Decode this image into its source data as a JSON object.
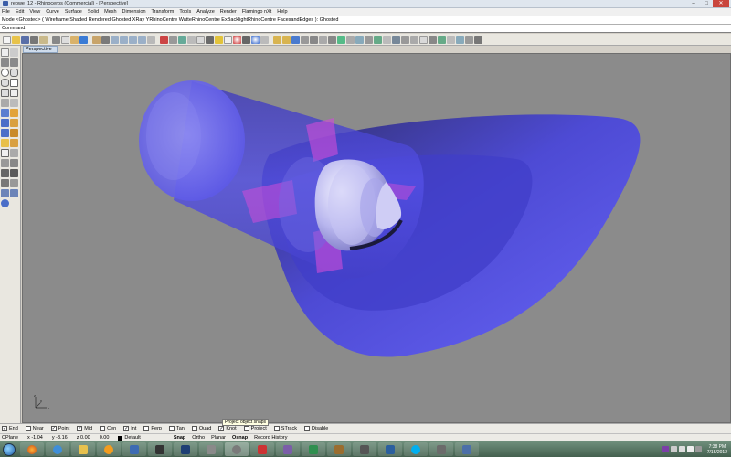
{
  "window": {
    "title": "repwe_12 - Rhinoceros (Commercial) - [Perspective]",
    "minimize": "–",
    "maximize": "□",
    "close": "✕"
  },
  "menu": [
    "File",
    "Edit",
    "View",
    "Curve",
    "Surface",
    "Solid",
    "Mesh",
    "Dimension",
    "Transform",
    "Tools",
    "Analyze",
    "Render",
    "Flamingo nXt",
    "Help"
  ],
  "command_history": "Mode <Ghosted> ( Wireframe  Shaded  Rendered  Ghosted  XRay  YRhinoCentre  WatteRhinoCentre  ExBacklightRhinoCentre  FacesandEdges ): Ghosted",
  "command_prompt": "Command:",
  "viewport": {
    "tab_label": "Perspective",
    "background": "#8b8b8b",
    "axis_x": "x",
    "axis_y": "y",
    "axis_z": "z"
  },
  "osnaps": [
    {
      "label": "End",
      "checked": true
    },
    {
      "label": "Near",
      "checked": false
    },
    {
      "label": "Point",
      "checked": true
    },
    {
      "label": "Mid",
      "checked": true
    },
    {
      "label": "Cen",
      "checked": false
    },
    {
      "label": "Int",
      "checked": true
    },
    {
      "label": "Perp",
      "checked": false
    },
    {
      "label": "Tan",
      "checked": false
    },
    {
      "label": "Quad",
      "checked": false
    },
    {
      "label": "Knot",
      "checked": true
    },
    {
      "label": "Project",
      "checked": false
    },
    {
      "label": "STrack",
      "checked": false
    },
    {
      "label": "Disable",
      "checked": false
    }
  ],
  "tooltip": "Project object snaps",
  "status": {
    "cplane": "CPlane",
    "x": "x -1.04",
    "y": "y -3.16",
    "z": "z 0.00",
    "extra": "0.00",
    "layer": "Default",
    "panes": [
      "Snap",
      "Ortho",
      "Planar",
      "Osnap",
      "Record History"
    ]
  },
  "clock": {
    "time": "7:38 PM",
    "date": "7/15/2012"
  },
  "colors": {
    "shape_blue": "#4a47e0",
    "inner_pink": "#d04cd8"
  }
}
